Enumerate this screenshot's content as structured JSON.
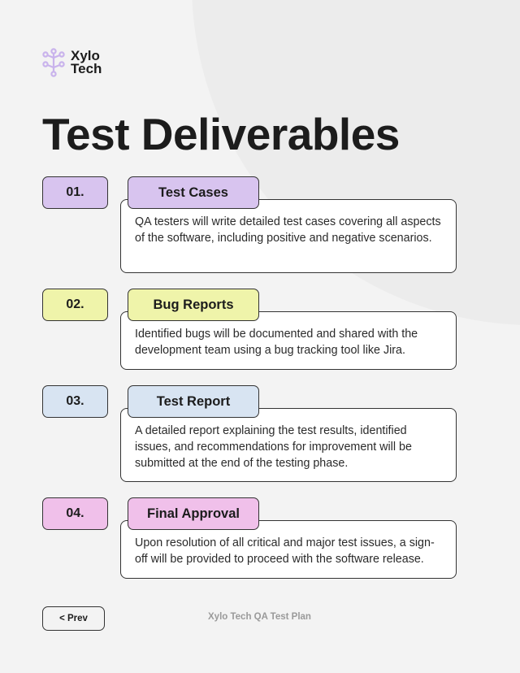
{
  "brand": {
    "name_line1": "Xylo",
    "name_line2": "Tech",
    "logo_icon": "network-tree-icon",
    "logo_color": "#c9b3ec"
  },
  "page": {
    "title": "Test Deliverables"
  },
  "deliverables": [
    {
      "number": "01.",
      "title": "Test Cases",
      "description": "QA testers will write detailed test cases covering all aspects of the software, including positive and negative scenarios.",
      "color": "#d8c4ef"
    },
    {
      "number": "02.",
      "title": "Bug Reports",
      "description": "Identified bugs will be documented and shared with the development team using a bug tracking tool like Jira.",
      "color": "#eff4aa"
    },
    {
      "number": "03.",
      "title": "Test Report",
      "description": "A detailed report explaining the test results, identified issues, and recommendations for improvement will be submitted at the end of the testing phase.",
      "color": "#d8e4f2"
    },
    {
      "number": "04.",
      "title": "Final Approval",
      "description": "Upon resolution of all critical and major test issues, a sign-off will be provided to proceed with the software release.",
      "color": "#f0c0ea"
    }
  ],
  "footer": {
    "prev_label": "< Prev",
    "document_name": "Xylo Tech QA Test Plan"
  }
}
